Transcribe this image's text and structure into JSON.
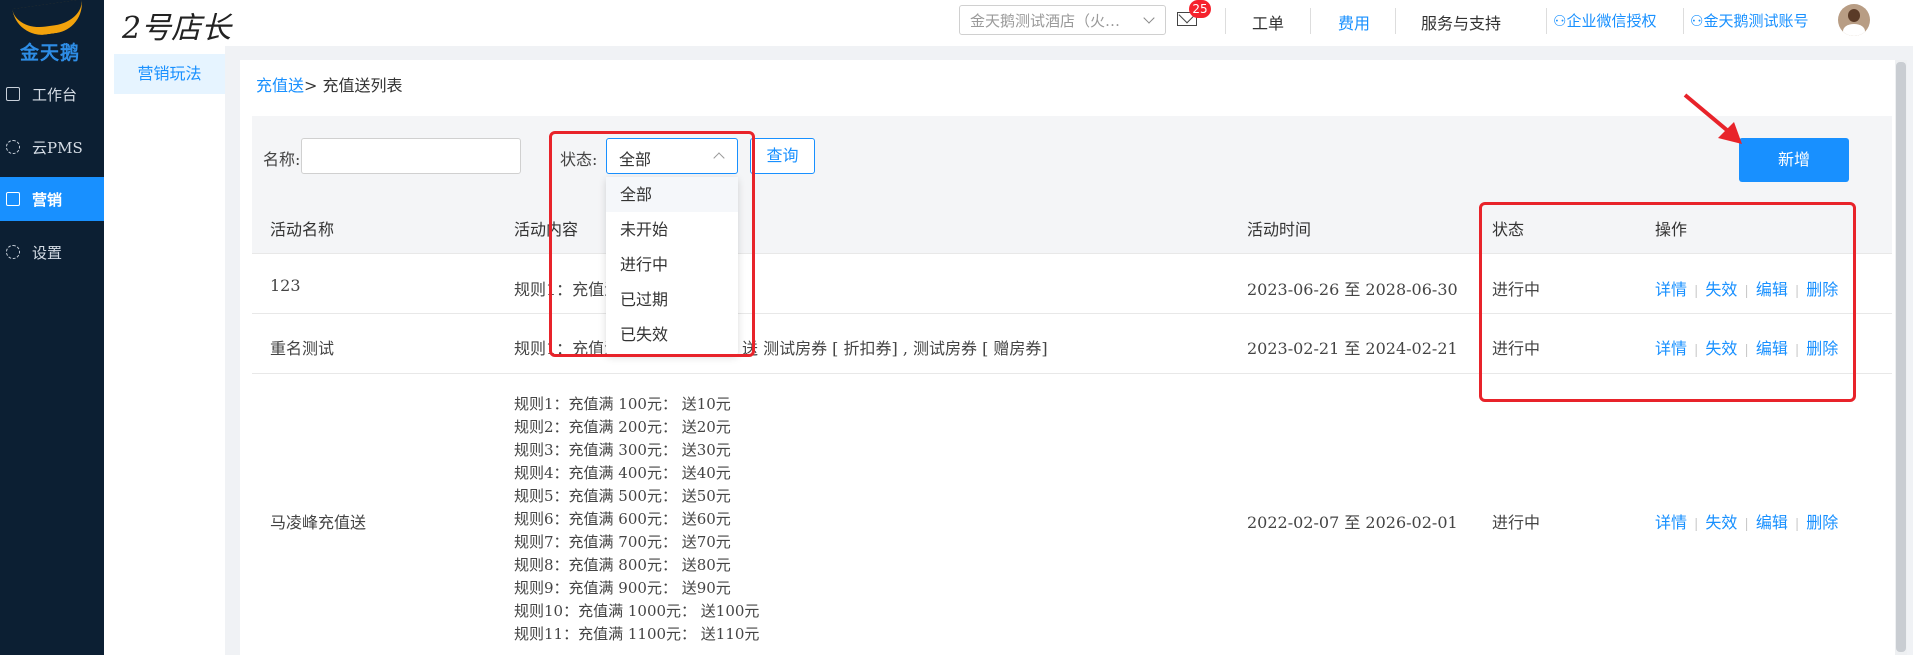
{
  "sidebar": {
    "brand": "金天鹅",
    "items": [
      {
        "label": "工作台",
        "active": false
      },
      {
        "label": "云PMS",
        "active": false
      },
      {
        "label": "营销",
        "active": true
      },
      {
        "label": "设置",
        "active": false
      }
    ]
  },
  "header": {
    "app_title": "2号店长",
    "hotel_select": "金天鹅测试酒店（火…",
    "mail_badge": "25",
    "links": [
      "工单",
      "费用",
      "服务与支持",
      "企业微信授权",
      "金天鹅测试账号"
    ]
  },
  "subnav": {
    "item": "营销玩法"
  },
  "breadcrumb": {
    "parent": "充值送",
    "current": "> 充值送列表"
  },
  "filters": {
    "name_label": "名称:",
    "name_value": "",
    "status_label": "状态:",
    "status_value": "全部",
    "query_label": "查询",
    "add_label": "新增",
    "status_options": [
      "全部",
      "未开始",
      "进行中",
      "已过期",
      "已失效"
    ]
  },
  "table": {
    "headers": [
      "活动名称",
      "活动内容",
      "活动时间",
      "状态",
      "操作"
    ],
    "ops": [
      "详情",
      "失效",
      "编辑",
      "删除"
    ],
    "rows": [
      {
        "name": "123",
        "content": "规则1：充值满",
        "time": "2023-06-26 至 2028-06-30",
        "status": "进行中"
      },
      {
        "name": "重名测试",
        "content": "规则1：充值满",
        "content_tail": "送 测试房券 [ 折扣券] , 测试房券 [ 赠房券]",
        "time": "2023-02-21 至 2024-02-21",
        "status": "进行中"
      },
      {
        "name": "马凌峰充值送",
        "time": "2022-02-07 至 2026-02-01",
        "status": "进行中",
        "rules": [
          "规则1：充值满 100元： 送10元",
          "规则2：充值满 200元： 送20元",
          "规则3：充值满 300元： 送30元",
          "规则4：充值满 400元： 送40元",
          "规则5：充值满 500元： 送50元",
          "规则6：充值满 600元： 送60元",
          "规则7：充值满 700元： 送70元",
          "规则8：充值满 800元： 送80元",
          "规则9：充值满 900元： 送90元",
          "规则10：充值满 1000元： 送100元",
          "规则11：充值满 1100元： 送110元"
        ]
      }
    ]
  },
  "colors": {
    "accent": "#1890ff",
    "annotation": "#e8232a",
    "nav_bg": "#0c1f33"
  }
}
